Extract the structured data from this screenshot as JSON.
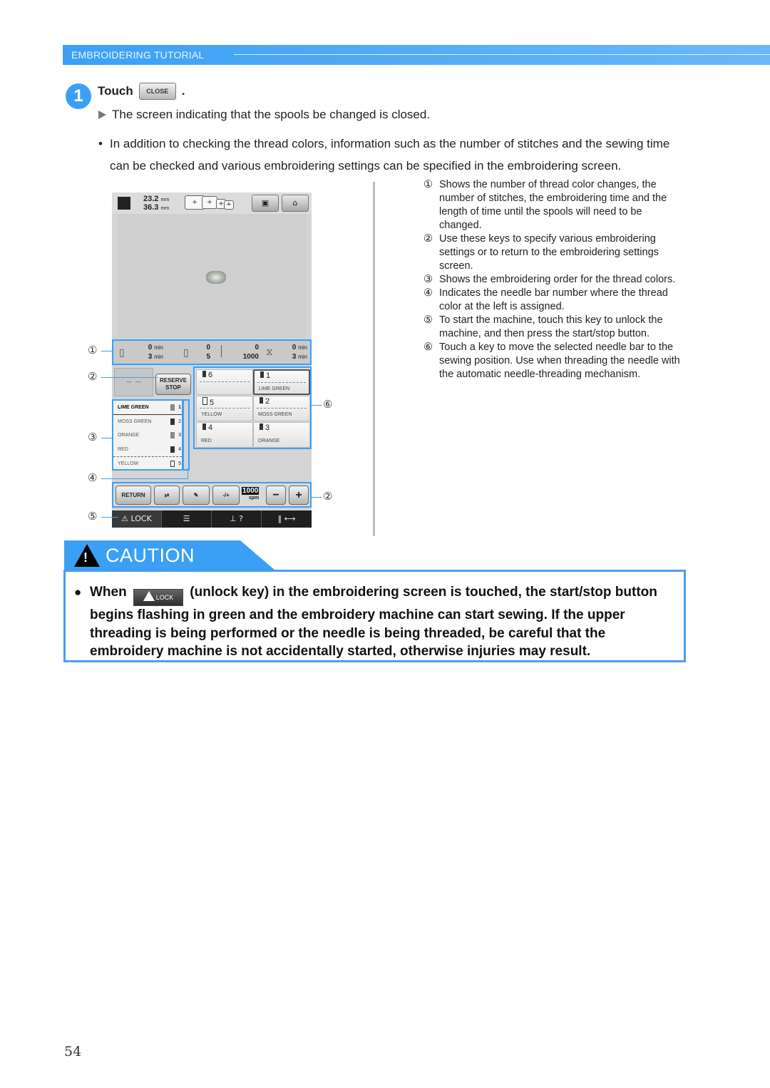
{
  "header": {
    "section_title": "EMBROIDERING TUTORIAL"
  },
  "step": {
    "number": "1",
    "prefix": "Touch",
    "button_label": "CLOSE",
    "suffix": ".",
    "result": "The screen indicating that the spools be changed is closed.",
    "bullet": "In addition to checking the thread colors, information such as the number of stitches and the sewing time can be checked and various embroidering settings can be specified in the embroidering screen."
  },
  "screen": {
    "width_value": "23.2",
    "height_value": "36.3",
    "unit": "mm",
    "frame_icons": [
      "+",
      "+",
      "+",
      "+"
    ],
    "info": {
      "spool_time_top": "0",
      "spool_time_bottom": "3",
      "time_unit": "min",
      "color_changes_top": "0",
      "color_changes_bottom": "5",
      "stitches_top": "0",
      "stitches_bottom": "1000",
      "sew_time_top": "0",
      "sew_time_bottom": "3"
    },
    "reserve_stop": [
      "RESERVE",
      "STOP"
    ],
    "thread_order": [
      {
        "color": "LIME GREEN",
        "needle": "1",
        "active": true
      },
      {
        "color": "MOSS GREEN",
        "needle": "2"
      },
      {
        "color": "ORANGE",
        "needle": "3"
      },
      {
        "color": "RED",
        "needle": "4"
      },
      {
        "color": "YELLOW",
        "needle": "5"
      }
    ],
    "needle_keys": [
      {
        "num": "6",
        "color": ""
      },
      {
        "num": "1",
        "color": "LIME GREEN",
        "selected": true
      },
      {
        "num": "5",
        "color": "YELLOW"
      },
      {
        "num": "2",
        "color": "MOSS GREEN"
      },
      {
        "num": "4",
        "color": "RED"
      },
      {
        "num": "3",
        "color": "ORANGE"
      }
    ],
    "buttons": {
      "return": "RETURN",
      "speed_value": "1000",
      "speed_unit": "spm",
      "minus": "−",
      "plus": "+",
      "needle_adjust": "-/+"
    },
    "bottom": {
      "lock": "LOCK",
      "help": "?",
      "arrows": "⟷"
    }
  },
  "callouts": [
    "①",
    "②",
    "③",
    "④",
    "⑤",
    "⑥",
    "②"
  ],
  "legend": [
    {
      "mark": "①",
      "text": "Shows the number of thread color changes, the number of stitches, the embroidering time and the length of time until the spools will need to be changed."
    },
    {
      "mark": "②",
      "text": "Use these keys to specify various embroidering settings or to return to the embroidering settings screen."
    },
    {
      "mark": "③",
      "text": "Shows the embroidering order for the thread colors."
    },
    {
      "mark": "④",
      "text": "Indicates the needle bar number where the thread color at the left is assigned."
    },
    {
      "mark": "⑤",
      "text": "To start the machine, touch this key to unlock the machine, and then press the start/stop button."
    },
    {
      "mark": "⑥",
      "text": "Touch a key to move the selected needle bar to the sewing position. Use when threading the needle with the automatic needle-threading mechanism."
    }
  ],
  "caution": {
    "title": "CAUTION",
    "bullet": "●",
    "lead": "When",
    "key_label": "LOCK",
    "rest": "(unlock key) in the embroidering screen is touched, the start/stop button begins flashing in green and the embroidery machine can start sewing. If the upper threading is being performed or the needle is being threaded, be careful that the embroidery machine is not accidentally started, otherwise injuries may result."
  },
  "page_number": "54",
  "colors": {
    "accent": "#3ba0f5",
    "caution_border": "#4a9df0"
  }
}
